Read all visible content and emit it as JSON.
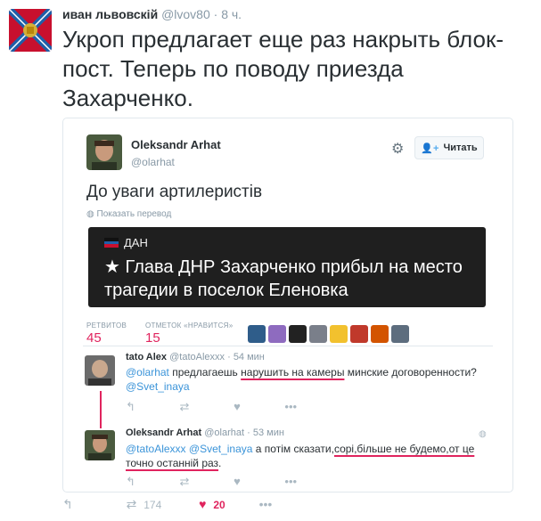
{
  "outer": {
    "name": "иван львовскій",
    "handle": "@lvov80",
    "time": "· 8 ч.",
    "text": "Укроп предлагает еще раз накрыть блок-пост. Теперь по поводу приезда Захарченко.",
    "retweets": "174",
    "likes": "20"
  },
  "embedded": {
    "name": "Oleksandr Arhat",
    "handle": "@olarhat",
    "follow_label": "Читать",
    "text": "До уваги артилеристів",
    "translate": "Показать перевод",
    "news_source": "ДАН",
    "news_headline": "★ Глава ДНР Захарченко прибыл на место трагедии в поселок Еленовка",
    "retweets_label": "РЕТВИТОВ",
    "retweets_value": "45",
    "likes_label": "ОТМЕТОК «НРАВИТСЯ»",
    "likes_value": "15"
  },
  "replies": [
    {
      "name": "tato Alex",
      "handle": "@tatoAlexxx",
      "time": "· 54 мин",
      "mention1": "@olarhat",
      "t1": " предлагаешь ",
      "underlined": "нарушить на камеры",
      "t2": " минские договоренности?",
      "mention2": "@Svet_inaya"
    },
    {
      "name": "Oleksandr Arhat",
      "handle": "@olarhat",
      "time": "· 53 мин",
      "mention1": "@tatoAlexxx",
      "mention2": "@Svet_inaya",
      "t1": " а потім сказати,",
      "underlined1": "сорі,більше не будемо,от це",
      "underlined2": "точно останній раз",
      "t2": "."
    }
  ],
  "icons": {
    "reply": "reply-icon",
    "retweet": "retweet-icon",
    "like": "heart-icon",
    "more": "more-icon",
    "gear": "gear-icon",
    "follow": "user-plus-icon",
    "globe": "globe-icon"
  },
  "colors": {
    "link": "#3b94d9",
    "accent": "#e0245e",
    "muted": "#8899a6"
  }
}
